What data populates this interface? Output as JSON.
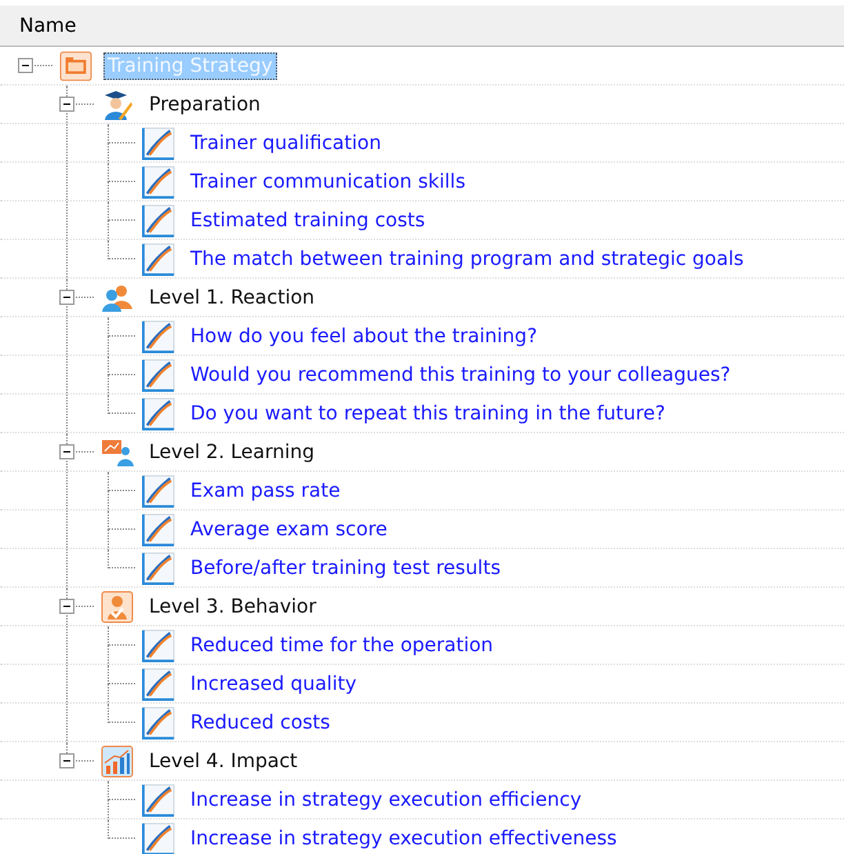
{
  "header": {
    "label": "Name"
  },
  "tree": [
    {
      "label": "Training Strategy",
      "kind": "strategy",
      "selected": true,
      "expanded": true,
      "children": [
        {
          "label": "Preparation",
          "kind": "graduate",
          "selected": false,
          "expanded": true,
          "children": [
            {
              "label": "Trainer qualification",
              "kind": "metric",
              "selected": false
            },
            {
              "label": "Trainer communication skills",
              "kind": "metric",
              "selected": false
            },
            {
              "label": "Estimated training costs",
              "kind": "metric",
              "selected": false
            },
            {
              "label": "The match between training program and strategic goals",
              "kind": "metric",
              "selected": false
            }
          ]
        },
        {
          "label": "Level 1. Reaction",
          "kind": "team",
          "selected": false,
          "expanded": true,
          "children": [
            {
              "label": "How do you feel about the training?",
              "kind": "metric",
              "selected": false
            },
            {
              "label": "Would you recommend this training to your colleagues?",
              "kind": "metric",
              "selected": false
            },
            {
              "label": "Do you want to repeat this training in the future?",
              "kind": "metric",
              "selected": false
            }
          ]
        },
        {
          "label": "Level 2. Learning",
          "kind": "presenter",
          "selected": false,
          "expanded": true,
          "children": [
            {
              "label": "Exam pass rate",
              "kind": "metric",
              "selected": false
            },
            {
              "label": "Average exam score",
              "kind": "metric",
              "selected": false
            },
            {
              "label": "Before/after training test results",
              "kind": "metric",
              "selected": false
            }
          ]
        },
        {
          "label": "Level 3. Behavior",
          "kind": "approved",
          "selected": false,
          "expanded": true,
          "children": [
            {
              "label": "Reduced time for the operation",
              "kind": "metric",
              "selected": false
            },
            {
              "label": "Increased quality",
              "kind": "metric",
              "selected": false
            },
            {
              "label": "Reduced costs",
              "kind": "metric",
              "selected": false
            }
          ]
        },
        {
          "label": "Level 4. Impact",
          "kind": "growth",
          "selected": false,
          "expanded": true,
          "children": [
            {
              "label": "Increase in strategy execution efficiency",
              "kind": "metric",
              "selected": false
            },
            {
              "label": "Increase in strategy execution effectiveness",
              "kind": "metric",
              "selected": false
            }
          ]
        }
      ]
    }
  ]
}
